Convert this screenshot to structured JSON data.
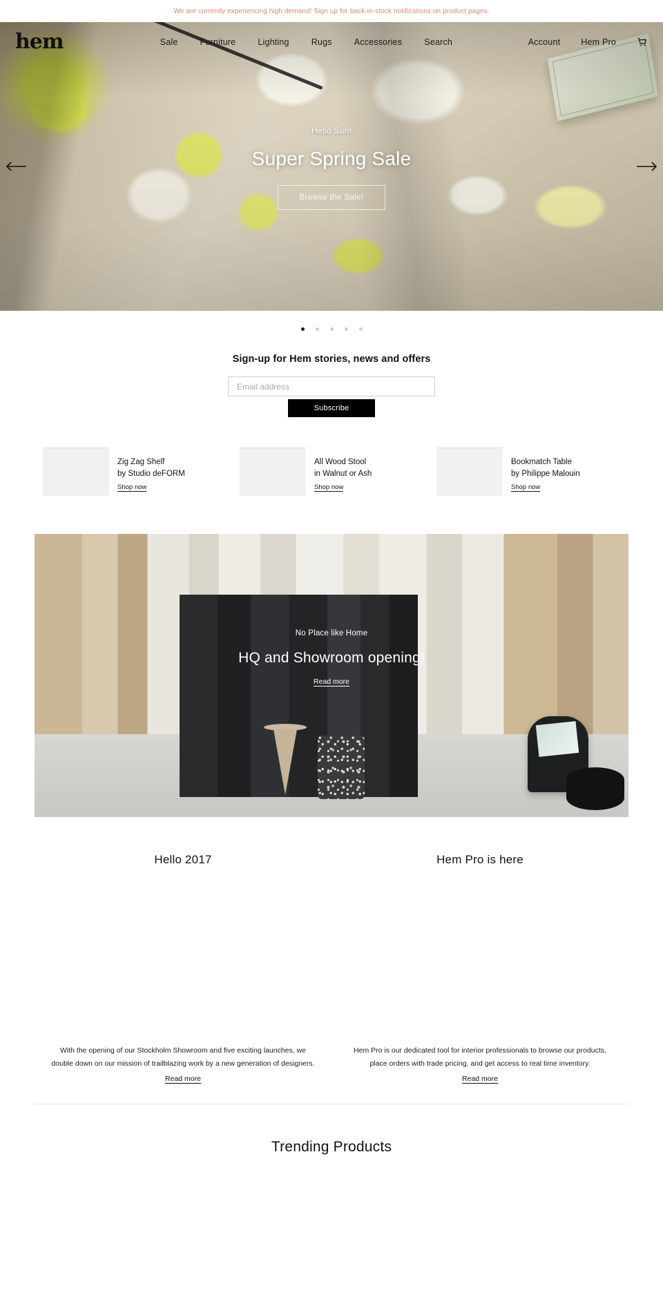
{
  "announcement": {
    "text": "We are currently experiencing high demand! Sign up for back-in-stock notifications on product pages.",
    "color": "#d98a72"
  },
  "header": {
    "logo": "hem",
    "nav": [
      {
        "label": "Sale"
      },
      {
        "label": "Furniture"
      },
      {
        "label": "Lighting"
      },
      {
        "label": "Rugs"
      },
      {
        "label": "Accessories"
      },
      {
        "label": "Search"
      }
    ],
    "right": [
      {
        "label": "Account"
      },
      {
        "label": "Hem Pro"
      }
    ],
    "cart_icon": "shopping-cart-icon"
  },
  "hero": {
    "eyebrow": "Hello Sun!",
    "title": "Super Spring Sale",
    "button": "Browse the Sale!",
    "prev_icon": "arrow-left-icon",
    "next_icon": "arrow-right-icon",
    "slide_count": 5,
    "active_slide": 1
  },
  "newsletter": {
    "heading": "Sign-up for Hem stories, news and offers",
    "email_placeholder": "Email address",
    "email_value": "",
    "subscribe_label": "Subscribe"
  },
  "promos": [
    {
      "line1": "Zig Zag Shelf",
      "line2": "by Studio deFORM",
      "cta": "Shop now"
    },
    {
      "line1": "All Wood Stool",
      "line2": "in Walnut or Ash",
      "cta": "Shop now"
    },
    {
      "line1": "Bookmatch Table",
      "line2": "by Philippe Malouin",
      "cta": "Shop now"
    }
  ],
  "feature": {
    "eyebrow": "No Place like Home",
    "title": "HQ and Showroom opening!",
    "link": "Read more"
  },
  "editorial": [
    {
      "title": "Hello 2017",
      "text": "With the opening of our Stockholm Showroom and five exciting launches, we double down on our mission of trailblazing work by a new generation of designers.",
      "link": "Read more"
    },
    {
      "title": "Hem Pro is here",
      "text": "Hem Pro is our dedicated tool for interior professionals to browse our products, place orders with trade pricing, and get access to real time inventory.",
      "link": "Read more"
    }
  ],
  "trending": {
    "heading": "Trending Products"
  }
}
